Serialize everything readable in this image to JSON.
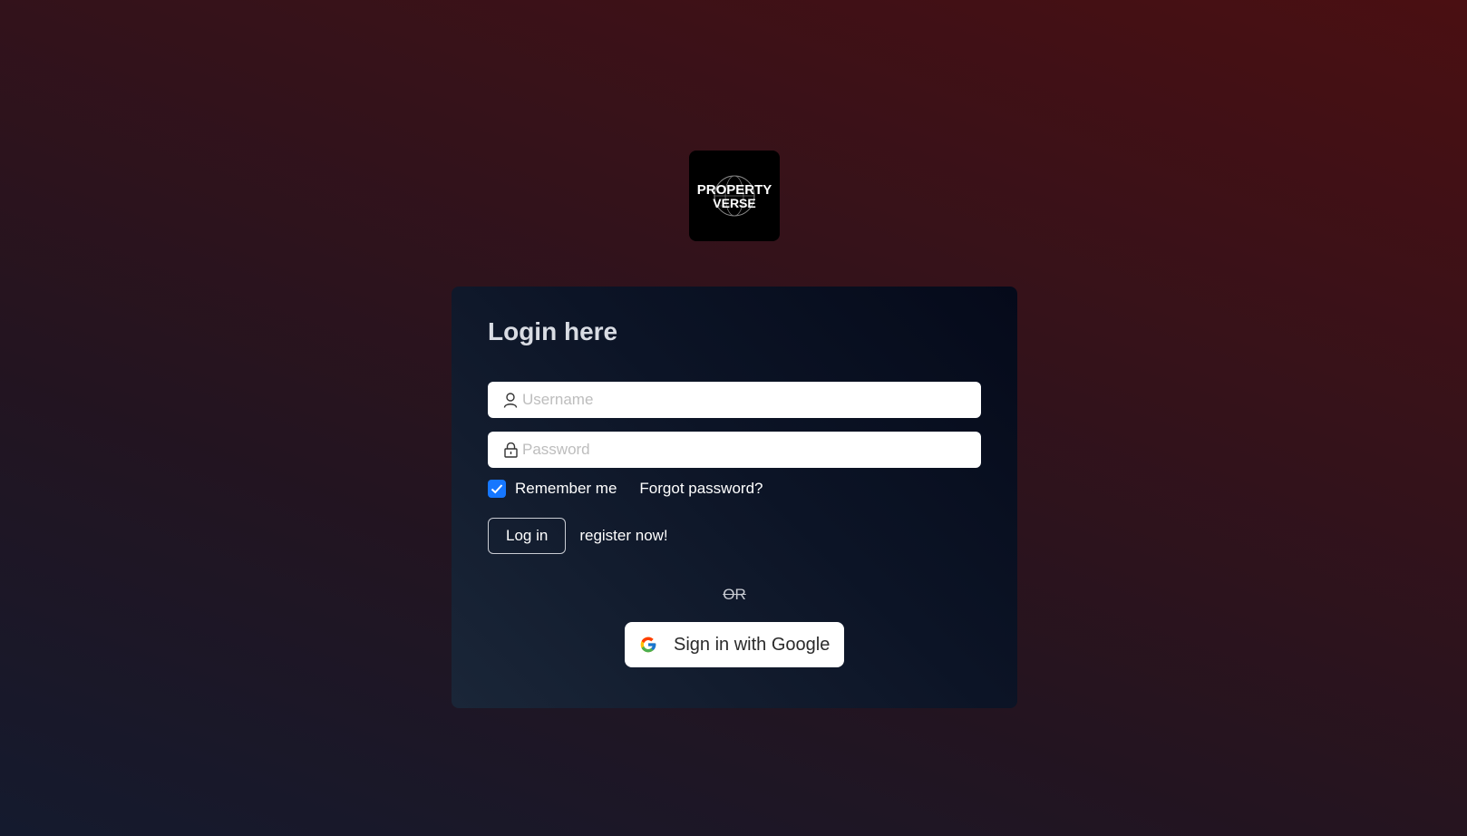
{
  "logo": {
    "line1": "PROPERTY",
    "line2": "VERSE"
  },
  "login": {
    "title": "Login here",
    "username_placeholder": "Username",
    "password_placeholder": "Password",
    "remember_label": "Remember me",
    "remember_checked": true,
    "forgot_label": "Forgot password?",
    "login_button_label": "Log in",
    "register_label": "register now!",
    "or_label": "OR",
    "google_button_label": "Sign in with Google"
  },
  "icons": {
    "username": "user-icon",
    "password": "lock-icon",
    "remember": "check-icon",
    "google": "google-icon"
  },
  "colors": {
    "accent": "#1677ff",
    "card_bg": "#0c1426",
    "page_bg_top": "#4a0f12",
    "page_bg_bottom": "#141a2e"
  }
}
